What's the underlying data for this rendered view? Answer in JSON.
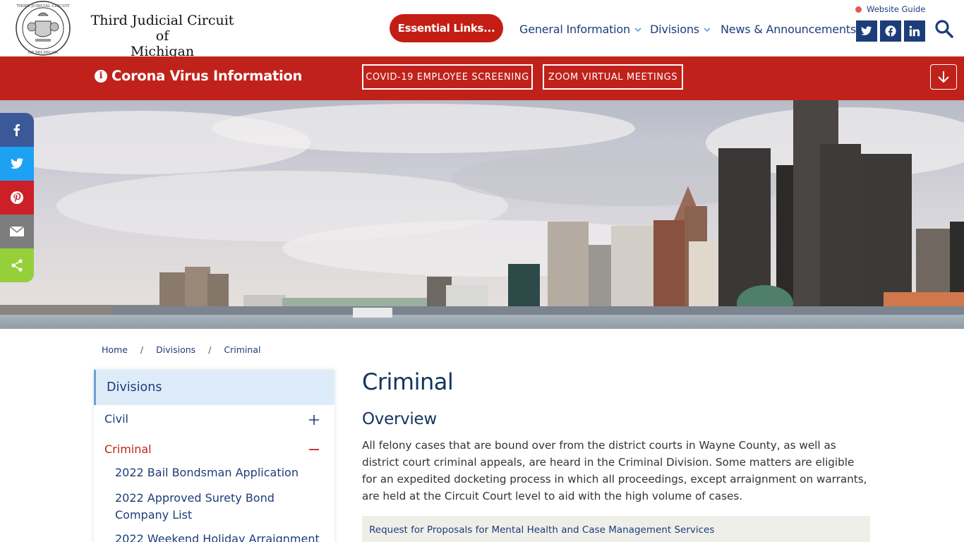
{
  "header": {
    "site_title_line1": "Third Judicial Circuit of",
    "site_title_line2": "Michigan",
    "seal_text_top": "THIRD JUDICIAL CIRCUIT",
    "seal_text_bottom": "OF MICHIGAN",
    "essential_links_label": "Essential Links...",
    "nav": [
      {
        "label": "General Information",
        "has_dropdown": true
      },
      {
        "label": "Divisions",
        "has_dropdown": true
      },
      {
        "label": "News & Announcements",
        "has_dropdown": false
      }
    ],
    "website_guide_label": "Website Guide",
    "social": [
      "twitter-icon",
      "facebook-icon",
      "linkedin-icon"
    ],
    "brand_color": "#1d3d7a"
  },
  "covid_bar": {
    "title": "Corona Virus Information",
    "buttons": [
      "COVID-19 EMPLOYEE SCREENING",
      "ZOOM VIRTUAL MEETINGS"
    ],
    "bg_color": "#c0221b"
  },
  "share_bar": [
    {
      "icon": "facebook-icon",
      "color": "#3b5998"
    },
    {
      "icon": "twitter-icon",
      "color": "#1da1f2"
    },
    {
      "icon": "pinterest-icon",
      "color": "#cb2027"
    },
    {
      "icon": "email-icon",
      "color": "#7d7d7d"
    },
    {
      "icon": "share-icon",
      "color": "#95d03a"
    }
  ],
  "breadcrumb": [
    "Home",
    "Divisions",
    "Criminal"
  ],
  "sidebar": {
    "heading": "Divisions",
    "items": [
      {
        "label": "Civil",
        "expanded": false
      },
      {
        "label": "Criminal",
        "expanded": true
      }
    ],
    "sub_items": [
      "2022 Bail Bondsman Application",
      "2022 Approved Surety Bond Company List",
      "2022 Weekend Holiday Arraignment"
    ]
  },
  "main": {
    "title": "Criminal",
    "section_heading": "Overview",
    "paragraph": "All felony cases that are bound over from the district courts in Wayne County, as well as district court criminal appeals, are heard in the Criminal Division. Some matters are eligible for an expedited docketing process in which all proceedings, except arraignment on warrants, are held at the Circuit Court level to aid with the high volume of cases.",
    "notice_link": "Request for Proposals for Mental Health and Case Management Services"
  }
}
